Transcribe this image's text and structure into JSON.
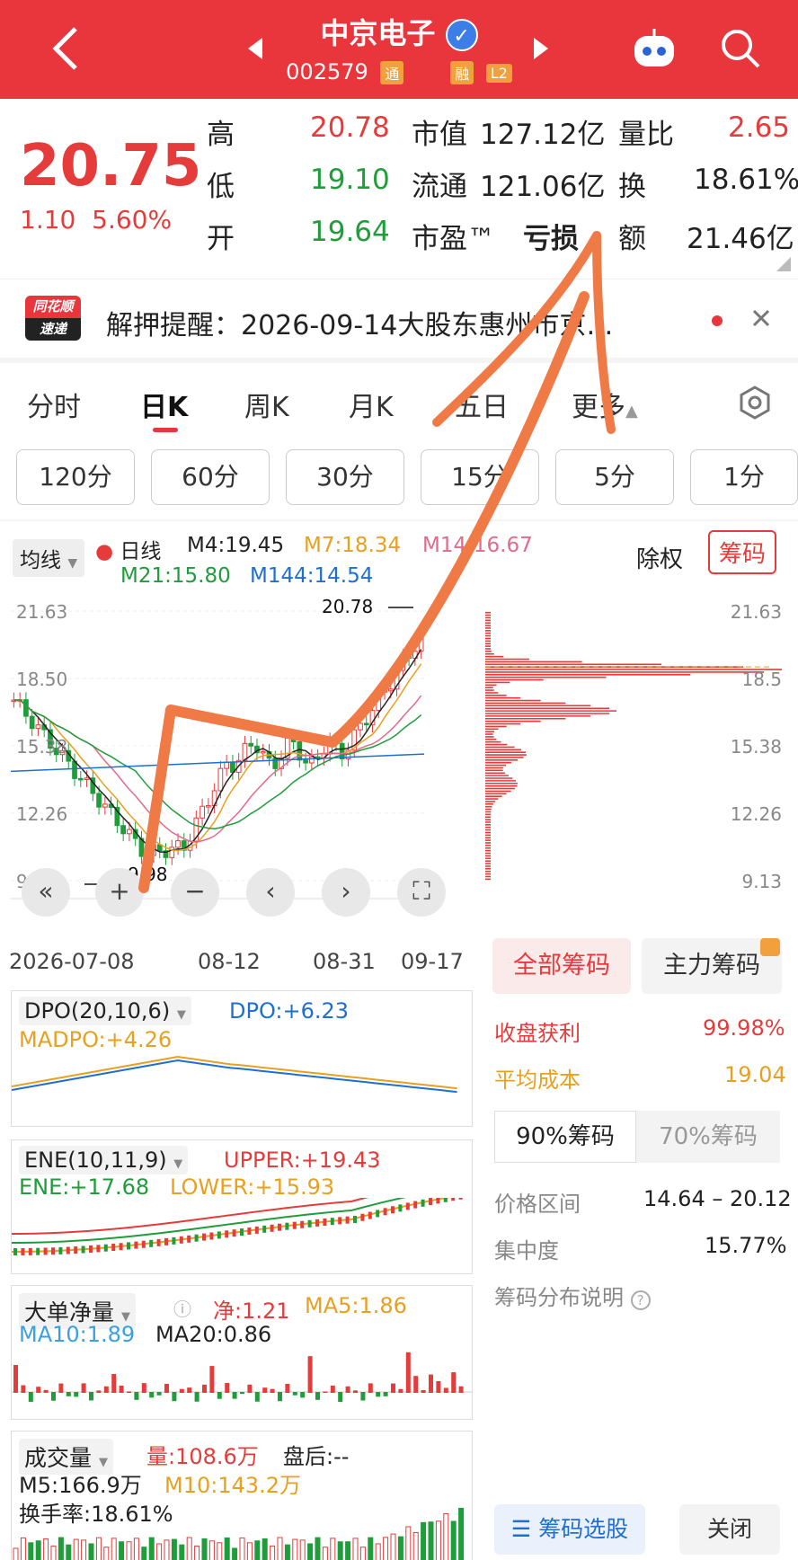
{
  "header": {
    "title": "中京电子",
    "code": "002579",
    "tags": [
      "通",
      "融",
      "L2"
    ]
  },
  "quote": {
    "price": "20.75",
    "change": "1.10",
    "change_pct": "5.60%",
    "high_label": "高",
    "high": "20.78",
    "low_label": "低",
    "low": "19.10",
    "open_label": "开",
    "open": "19.64",
    "mcap_label": "市值",
    "mcap": "127.12亿",
    "float_label": "流通",
    "float": "121.06亿",
    "pe_label": "市盈™",
    "pe": "亏损",
    "vr_label": "量比",
    "vr": "2.65",
    "turn_label": "换",
    "turn": "18.61%",
    "amt_label": "额",
    "amt": "21.46亿"
  },
  "news": {
    "logo_top": "同花顺",
    "logo_bottom": "速递",
    "text": "解押提醒：2026-09-14大股东惠州市京…"
  },
  "tabs": [
    "分时",
    "日K",
    "周K",
    "月K",
    "五日",
    "更多"
  ],
  "periods": [
    "120分",
    "60分",
    "30分",
    "15分",
    "5分",
    "1分"
  ],
  "kline": {
    "ma_select": "均线",
    "day_label": "日线",
    "m4": "M4:19.45",
    "m7": "M7:18.34",
    "m14": "M14:16.67",
    "m21": "M21:15.80",
    "m144": "M144:14.54",
    "fq_label": "除权",
    "chip_label": "筹码",
    "y_ticks": [
      "21.63",
      "18.50",
      "15.38",
      "12.26",
      "9.13"
    ],
    "x_ticks": [
      "2026-07-08",
      "08-12",
      "08-31",
      "09-17"
    ],
    "high_note": "20.78",
    "low_note": "9.98"
  },
  "chips": {
    "y_ticks": [
      "21.63",
      "18.5",
      "15.38",
      "12.26",
      "9.13"
    ],
    "tab_all": "全部筹码",
    "tab_main": "主力筹码",
    "profit_label": "收盘获利",
    "profit": "99.98%",
    "avg_label": "平均成本",
    "avg": "19.04",
    "t90": "90%筹码",
    "t70": "70%筹码",
    "range_label": "价格区间",
    "range": "14.64 – 20.12",
    "conc_label": "集中度",
    "conc": "15.77%",
    "desc": "筹码分布说明",
    "select_btn": "筹码选股",
    "close_btn": "关闭"
  },
  "dpo": {
    "name": "DPO(20,10,6)",
    "dpo": "DPO:+6.23",
    "madpo": "MADPO:+4.26"
  },
  "ene": {
    "name": "ENE(10,11,9)",
    "upper": "UPPER:+19.43",
    "ene": "ENE:+17.68",
    "lower": "LOWER:+15.93"
  },
  "bignet": {
    "name": "大单净量",
    "net": "净:1.21",
    "ma5": "MA5:1.86",
    "ma10": "MA10:1.89",
    "ma20": "MA20:0.86"
  },
  "volume": {
    "name": "成交量",
    "vol": "量:108.6万",
    "after": "盘后:--",
    "m5": "M5:166.9万",
    "m10": "M10:143.2万",
    "turn": "换手率:18.61%"
  },
  "colors": {
    "red": "#e53b3b",
    "green": "#1f9d3a",
    "blue": "#1f6fd1",
    "orange": "#e8a020",
    "pink": "#e06b8a",
    "arrow": "#f07a45"
  }
}
